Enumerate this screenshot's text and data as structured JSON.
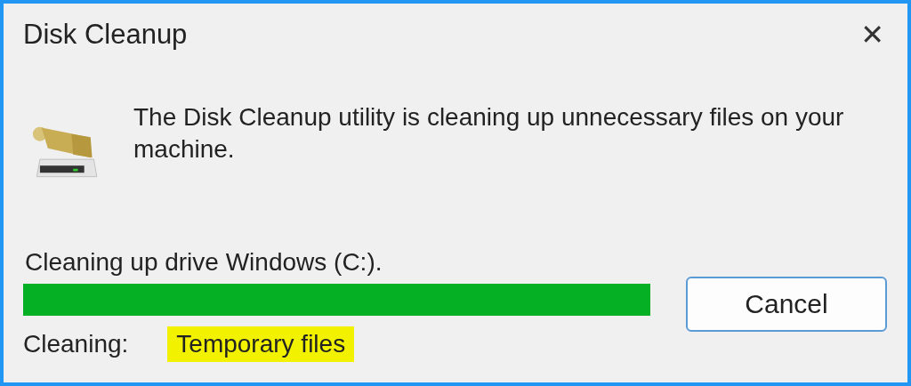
{
  "window": {
    "title": "Disk Cleanup",
    "close": "✕"
  },
  "message": "The Disk Cleanup utility is cleaning up unnecessary files on your machine.",
  "status": "Cleaning up drive Windows (C:).",
  "progress": {
    "level": 1
  },
  "buttons": [
    {
      "label": "Cancel"
    }
  ],
  "current": {
    "label": "Cleaning:",
    "value": "Temporary files",
    "highlighted": true
  }
}
